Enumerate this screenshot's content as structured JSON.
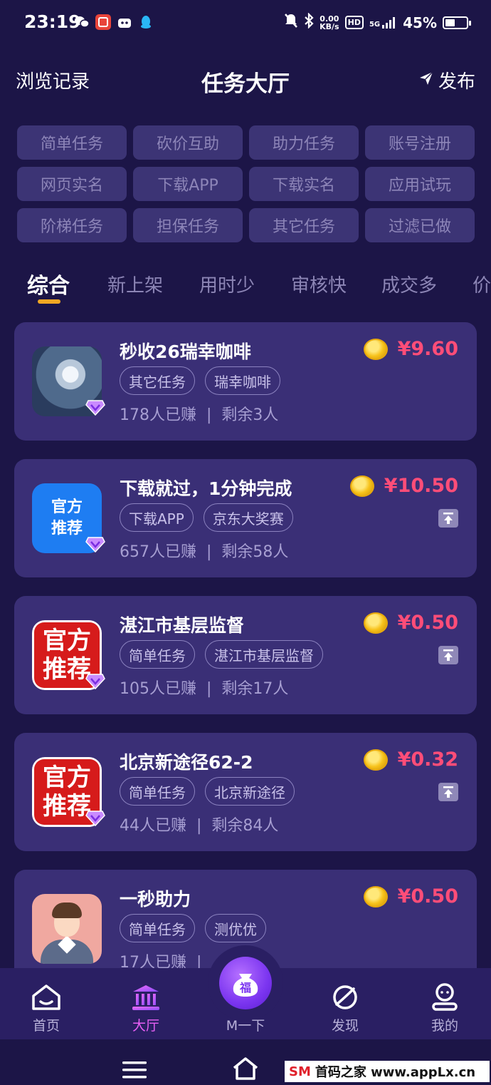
{
  "status_bar": {
    "time": "23:19",
    "net_speed_value": "0.00",
    "net_speed_unit": "KB/s",
    "hd": "HD",
    "signal": "5G",
    "battery_percent": "45%",
    "battery_level": 0.45
  },
  "header": {
    "left_label": "浏览记录",
    "title": "任务大厅",
    "right_label": "发布"
  },
  "categories": [
    "简单任务",
    "砍价互助",
    "助力任务",
    "账号注册",
    "网页实名",
    "下载APP",
    "下载实名",
    "应用试玩",
    "阶梯任务",
    "担保任务",
    "其它任务",
    "过滤已做"
  ],
  "sort_tabs": [
    "综合",
    "新上架",
    "用时少",
    "审核快",
    "成交多",
    "价"
  ],
  "tasks": [
    {
      "title": "秒收26瑞幸咖啡",
      "tags": [
        "其它任务",
        "瑞幸咖啡"
      ],
      "earned": "178人已赚",
      "remaining": "剩余3人",
      "price": "¥9.60",
      "icon": "dandelion-photo-icon",
      "pinned": false
    },
    {
      "title": "下载就过，1分钟完成",
      "tags": [
        "下载APP",
        "京东大奖赛"
      ],
      "earned": "657人已赚",
      "remaining": "剩余58人",
      "price": "¥10.50",
      "icon_text": "官方推荐",
      "icon": "official-recommend-blue-icon",
      "pinned": true
    },
    {
      "title": "湛江市基层监督",
      "tags": [
        "简单任务",
        "湛江市基层监督"
      ],
      "earned": "105人已赚",
      "remaining": "剩余17人",
      "price": "¥0.50",
      "icon_text": "官方推荐",
      "icon": "official-recommend-red-icon",
      "pinned": true
    },
    {
      "title": "北京新途径62-2",
      "tags": [
        "简单任务",
        "北京新途径"
      ],
      "earned": "44人已赚",
      "remaining": "剩余84人",
      "price": "¥0.32",
      "icon_text": "官方推荐",
      "icon": "official-recommend-red-icon",
      "pinned": true
    },
    {
      "title": "一秒助力",
      "tags": [
        "简单任务",
        "测优优"
      ],
      "earned": "17人已赚",
      "remaining": "",
      "price": "¥0.50",
      "icon": "avatar-boy-icon",
      "pinned": false
    }
  ],
  "bottom_nav": {
    "home": "首页",
    "hall": "大厅",
    "center": "M一下",
    "center_badge": "福",
    "discover": "发现",
    "mine": "我的"
  },
  "watermark": {
    "brand": "SM",
    "text": "首码之家 www.appLx.cn"
  },
  "colors": {
    "background": "#1c1547",
    "card": "#3a2f76",
    "price": "#ff4d78",
    "active_tab_underline": "#f3a823",
    "active_nav": "#e85ff5"
  }
}
